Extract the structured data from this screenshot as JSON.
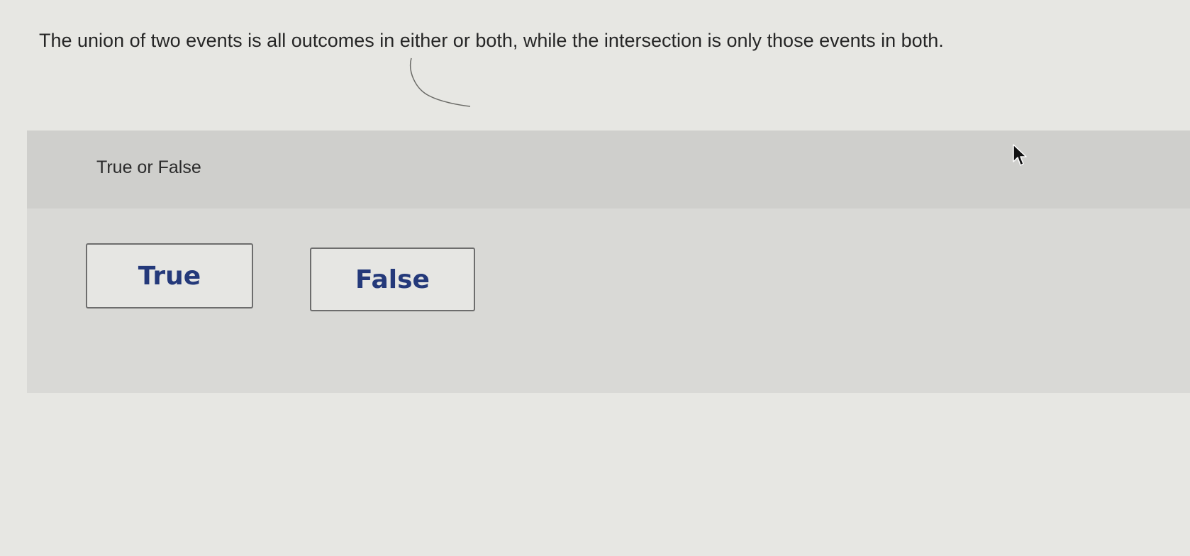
{
  "question": {
    "text": "The union of two events is all outcomes in either or both, while the intersection is only those events in both."
  },
  "prompt": {
    "label": "True or False"
  },
  "choices": [
    {
      "label": "True"
    },
    {
      "label": "False"
    }
  ],
  "colors": {
    "background": "#e7e7e3",
    "panel": "#d9d9d6",
    "panel_header": "#cfcfcc",
    "choice_text": "#24397a",
    "choice_border": "#6d6d6d"
  },
  "icons": {
    "cursor": "mouse-pointer-icon"
  }
}
